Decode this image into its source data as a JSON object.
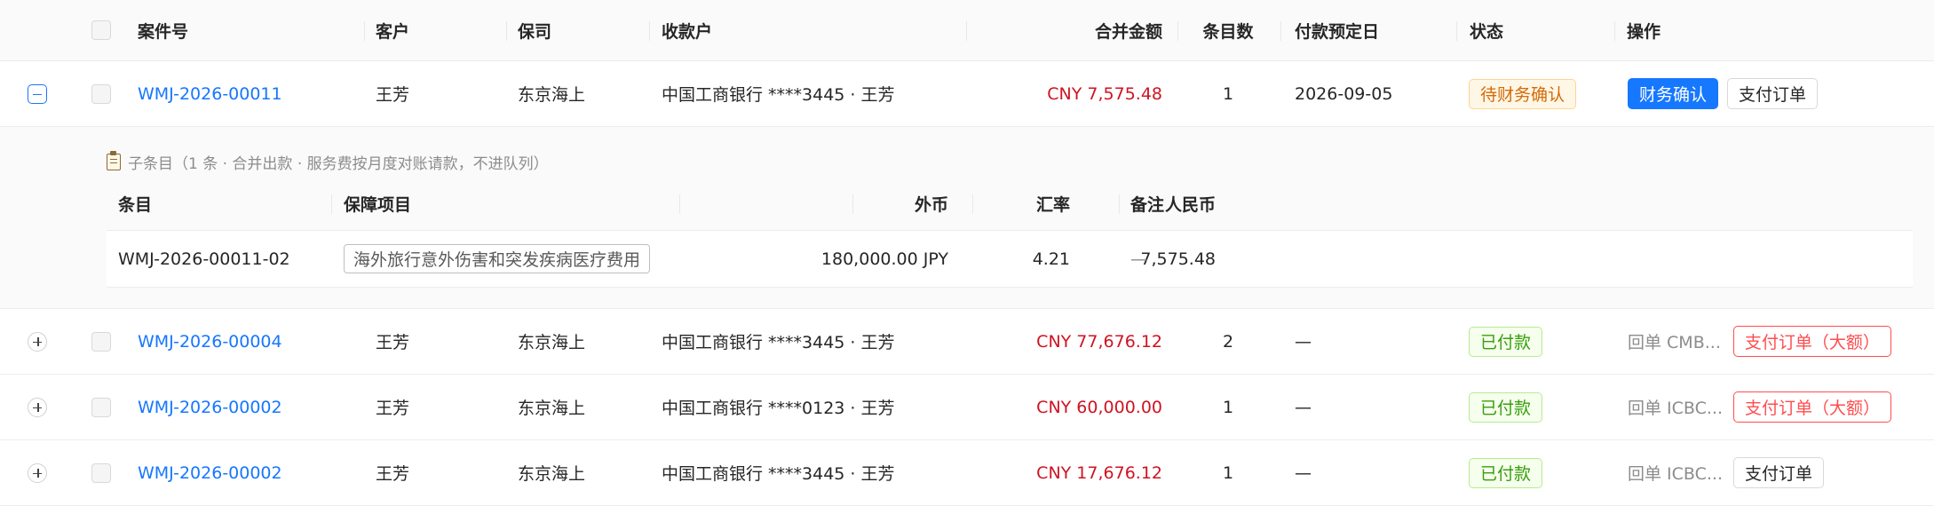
{
  "columns": {
    "case_no": "案件号",
    "customer": "客户",
    "insurer": "保司",
    "payee": "收款户",
    "total_amount": "合并金额",
    "item_count": "条目数",
    "due_date": "付款预定日",
    "status": "状态",
    "actions": "操作"
  },
  "rows": [
    {
      "case_no": "WMJ-2026-00011",
      "customer": "王芳",
      "insurer": "东京海上",
      "payee": "中国工商银行 ****3445 · 王芳",
      "amount": "CNY 7,575.48",
      "count": "1",
      "due": "2026-09-05",
      "status": "待财务确认",
      "action_primary": "财务确认",
      "action_secondary": "支付订单"
    },
    {
      "case_no": "WMJ-2026-00004",
      "customer": "王芳",
      "insurer": "东京海上",
      "payee": "中国工商银行 ****3445 · 王芳",
      "amount": "CNY 77,676.12",
      "count": "2",
      "due": "—",
      "status": "已付款",
      "receipt": "回单 CMB...",
      "action": "支付订单（大额）"
    },
    {
      "case_no": "WMJ-2026-00002",
      "customer": "王芳",
      "insurer": "东京海上",
      "payee": "中国工商银行 ****0123 · 王芳",
      "amount": "CNY 60,000.00",
      "count": "1",
      "due": "—",
      "status": "已付款",
      "receipt": "回单 ICBC...",
      "action": "支付订单（大额）"
    },
    {
      "case_no": "WMJ-2026-00002",
      "customer": "王芳",
      "insurer": "东京海上",
      "payee": "中国工商银行 ****3445 · 王芳",
      "amount": "CNY 17,676.12",
      "count": "1",
      "due": "—",
      "status": "已付款",
      "receipt": "回单 ICBC...",
      "action": "支付订单"
    }
  ],
  "sub_items": {
    "caption": "子条目（1 条 · 合并出款 · 服务费按月度对账请款，不进队列）",
    "icon": "clipboard-icon",
    "columns": {
      "item": "条目",
      "coverage": "保障项目",
      "foreign": "外币",
      "rate": "汇率",
      "cny": "人民币",
      "note": "备注"
    },
    "rows": [
      {
        "item": "WMJ-2026-00011-02",
        "coverage": "海外旅行意外伤害和突发疾病医疗费用",
        "foreign": "180,000.00 JPY",
        "rate": "4.21",
        "cny": "7,575.48",
        "note": "—"
      }
    ]
  },
  "colors": {
    "link": "#1677ff",
    "amount": "#cf1322",
    "status_pending": "#d46b08",
    "status_paid": "#389e0d",
    "danger": "#ff4d4f"
  }
}
